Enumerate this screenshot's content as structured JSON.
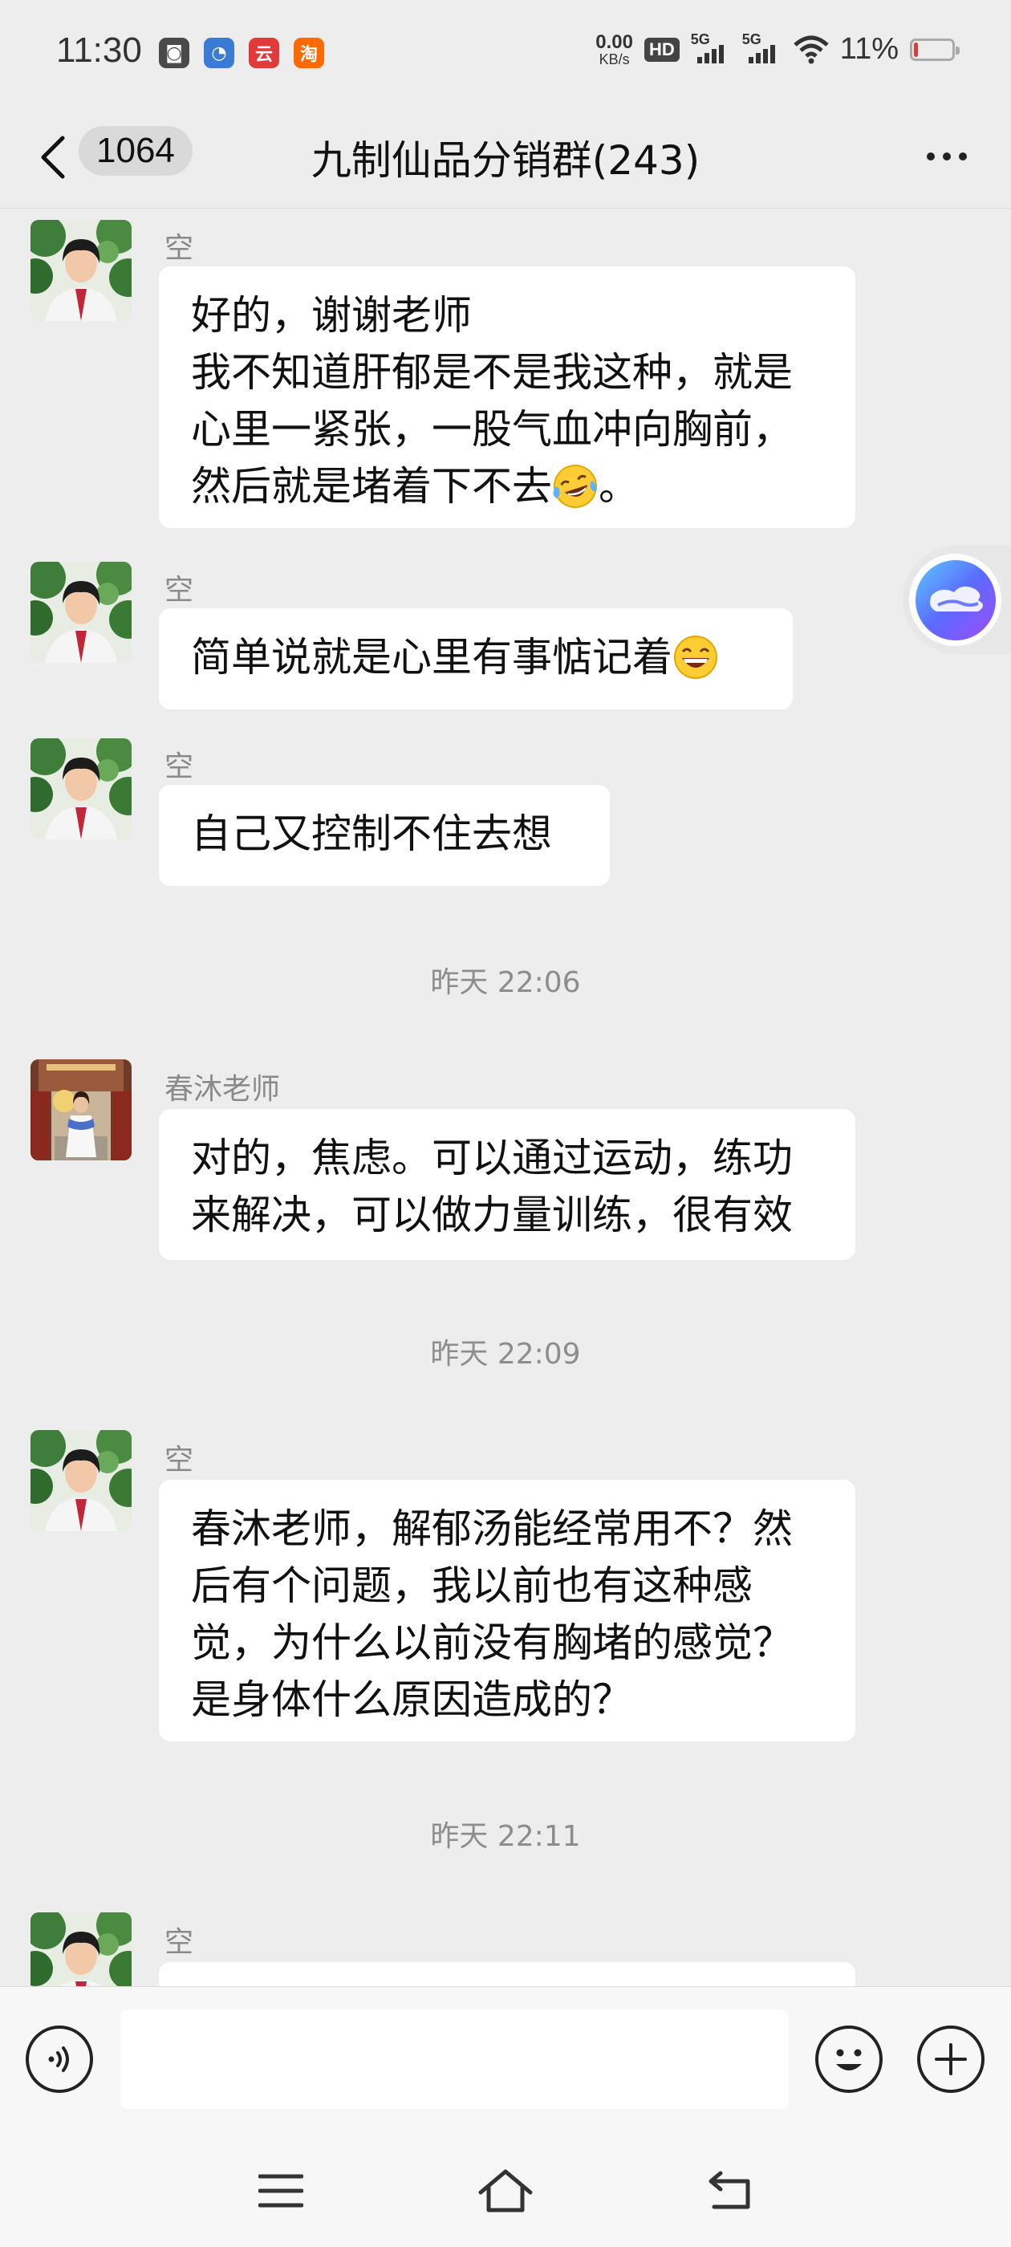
{
  "status_bar": {
    "time": "11:30",
    "app_icons": [
      {
        "name": "screen-record-icon",
        "glyph": "◙",
        "color": "#4a4a4a"
      },
      {
        "name": "chat-bubble-app-icon",
        "glyph": "◔",
        "color": "#3a7bd5"
      },
      {
        "name": "cloud-app-icon",
        "glyph": "云",
        "color": "#e23a3a"
      },
      {
        "name": "taobao-app-icon",
        "glyph": "淘",
        "color": "#ff6a00"
      }
    ],
    "net_speed_value": "0.00",
    "net_speed_unit": "KB/s",
    "hd_label": "HD",
    "sim1_label": "5G",
    "sim2_label": "5G",
    "battery_percent": "11%",
    "battery_level": 0.11
  },
  "header": {
    "unread_count": "1064",
    "title": "九制仙品分销群(243)"
  },
  "messages": [
    {
      "type": "msg",
      "sender": "空",
      "avatar": "kong",
      "lines": [
        "好的，谢谢老师",
        "我不知道肝郁是不是我这种，就是",
        "心里一紧张，一股气血冲向胸前，",
        "然后就是堵着下不去"
      ],
      "trailing_emoji": "crying-laugh-emoji",
      "trailing_text": "。"
    },
    {
      "type": "msg",
      "sender": "空",
      "avatar": "kong",
      "lines": [
        "简单说就是心里有事惦记着"
      ],
      "trailing_emoji": "grin-emoji",
      "trailing_text": ""
    },
    {
      "type": "msg",
      "sender": "空",
      "avatar": "kong",
      "lines": [
        "自己又控制不住去想"
      ]
    },
    {
      "type": "time",
      "text": "昨天 22:06"
    },
    {
      "type": "msg",
      "sender": "春沐老师",
      "avatar": "teacher",
      "lines": [
        "对的，焦虑。可以通过运动，练功",
        "来解决，可以做力量训练，很有效"
      ]
    },
    {
      "type": "time",
      "text": "昨天 22:09"
    },
    {
      "type": "msg",
      "sender": "空",
      "avatar": "kong",
      "lines": [
        "春沐老师，解郁汤能经常用不？然",
        "后有个问题，我以前也有这种感",
        "觉，为什么以前没有胸堵的感觉？",
        "是身体什么原因造成的？"
      ]
    },
    {
      "type": "time",
      "text": "昨天 22:11"
    },
    {
      "type": "msg",
      "sender": "空",
      "avatar": "kong",
      "lines": [
        ""
      ]
    }
  ],
  "input": {
    "value": "",
    "placeholder": ""
  },
  "icons": {
    "back": "chevron-left-icon",
    "more": "more-dots-icon",
    "voice": "voice-icon",
    "emoji": "smiley-icon",
    "plus": "plus-icon",
    "assistant": "cloud-assistant-icon",
    "nav_menu": "menu-icon",
    "nav_home": "home-icon",
    "nav_back": "back-arrow-icon"
  },
  "colors": {
    "background": "#ededed",
    "bubble": "#ffffff",
    "battery_low": "#e53935"
  }
}
